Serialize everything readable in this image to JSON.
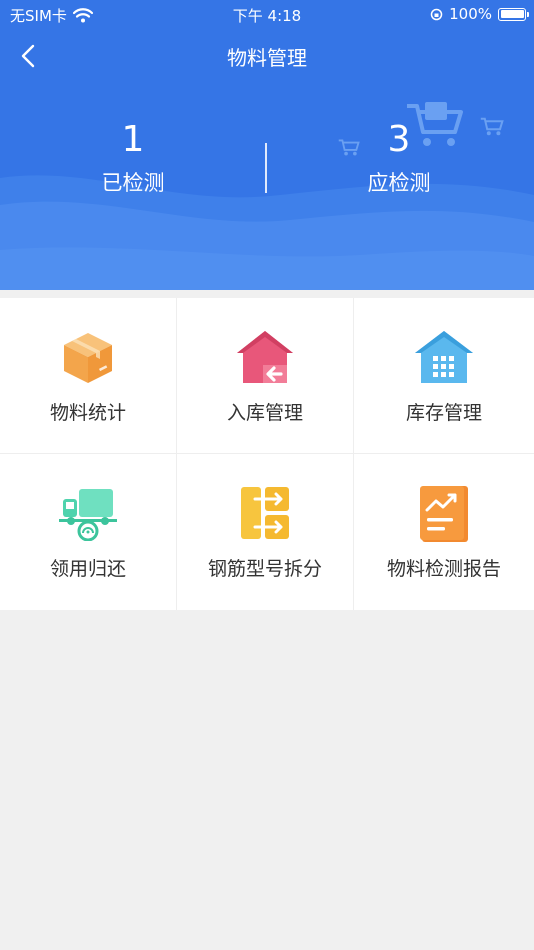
{
  "status_bar": {
    "carrier": "无SIM卡",
    "time": "下午 4:18",
    "battery": "100%"
  },
  "nav": {
    "title": "物料管理"
  },
  "stats": {
    "tested": {
      "count": "1",
      "label": "已检测"
    },
    "to_test": {
      "count": "3",
      "label": "应检测"
    }
  },
  "colors": {
    "header_blue": "#3575e6",
    "page_bg": "#f0f0f0"
  },
  "menu": [
    {
      "label": "物料统计",
      "icon": "box-icon"
    },
    {
      "label": "入库管理",
      "icon": "warehouse-inbound-icon"
    },
    {
      "label": "库存管理",
      "icon": "building-icon"
    },
    {
      "label": "领用归还",
      "icon": "truck-icon"
    },
    {
      "label": "钢筋型号拆分",
      "icon": "split-icon"
    },
    {
      "label": "物料检测报告",
      "icon": "report-chart-icon"
    }
  ]
}
